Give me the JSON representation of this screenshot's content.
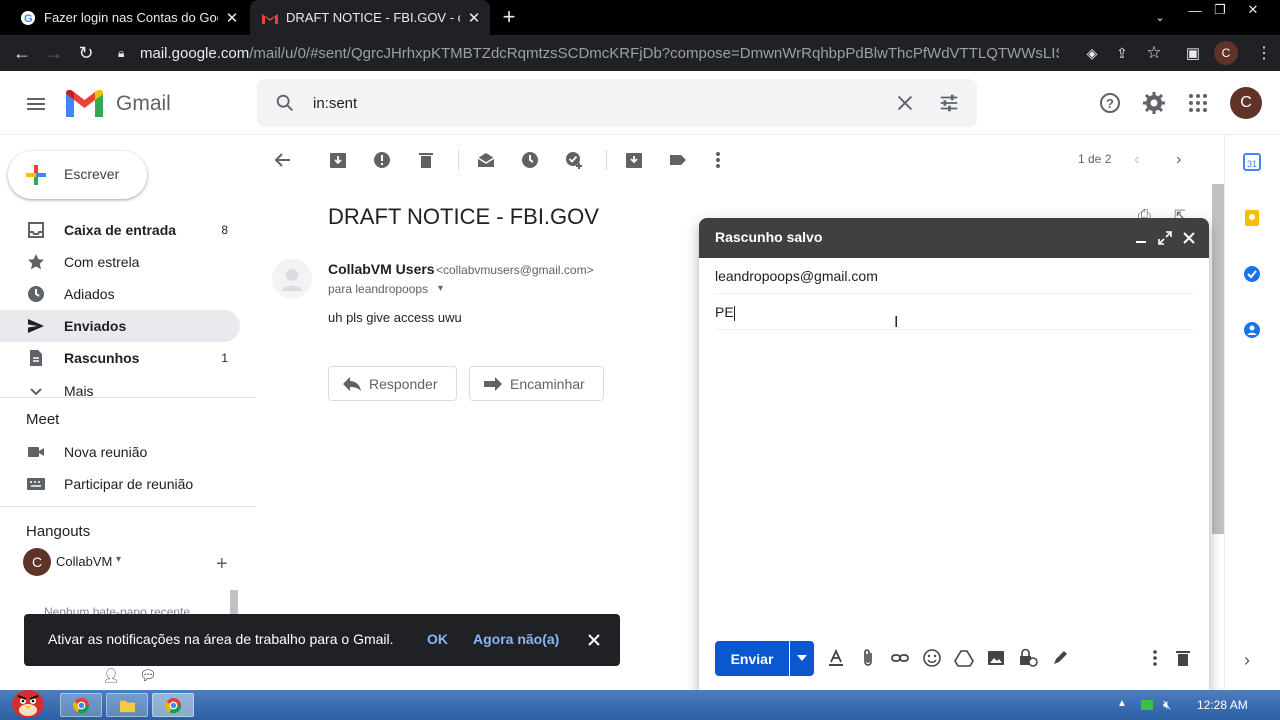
{
  "browser": {
    "tabs": [
      {
        "title": "Fazer login nas Contas do Goo"
      },
      {
        "title": "DRAFT NOTICE - FBI.GOV - coll"
      }
    ],
    "url_host": "mail.google.com",
    "url_path": "/mail/u/0/#sent/QgrcJHrhxpKTMBTZdcRqmtzsSCDmcKRFjDb?compose=DmwnWrRqhbpPdBlwThcPfWdVTTLQTWWsLIS...",
    "profile_initial": "C"
  },
  "header": {
    "app_name": "Gmail",
    "search_query": "in:sent",
    "avatar_initial": "C"
  },
  "sidebar": {
    "compose_label": "Escrever",
    "items": [
      {
        "label": "Caixa de entrada",
        "count": "8",
        "icon": "inbox-icon"
      },
      {
        "label": "Com estrela",
        "count": "",
        "icon": "star-icon"
      },
      {
        "label": "Adiados",
        "count": "",
        "icon": "clock-icon"
      },
      {
        "label": "Enviados",
        "count": "",
        "icon": "send-icon"
      },
      {
        "label": "Rascunhos",
        "count": "1",
        "icon": "draft-icon"
      },
      {
        "label": "Mais",
        "count": "",
        "icon": "chevron-down-icon"
      }
    ],
    "meet_title": "Meet",
    "meet_items": [
      {
        "label": "Nova reunião"
      },
      {
        "label": "Participar de reunião"
      }
    ],
    "hangouts_title": "Hangouts",
    "hangouts_user": "CollabVM",
    "hangouts_initial": "C",
    "hangouts_empty": "Nenhum bate-papo recente"
  },
  "toolbar": {
    "pager": "1 de 2"
  },
  "message": {
    "subject": "DRAFT NOTICE - FBI.GOV",
    "sender_name": "CollabVM Users",
    "sender_email": "<collabvmusers@gmail.com>",
    "to_line": "para leandropoops",
    "body": "uh pls give access  uwu",
    "reply_label": "Responder",
    "forward_label": "Encaminhar"
  },
  "compose": {
    "title": "Rascunho salvo",
    "to": "leandropoops@gmail.com",
    "subject": "PE",
    "send_label": "Enviar"
  },
  "snackbar": {
    "text": "Ativar as notificações na área de trabalho para o Gmail.",
    "ok": "OK",
    "later": "Agora não(a)"
  },
  "taskbar": {
    "clock": "12:28 AM"
  },
  "colors": {
    "accent": "#0b57d0",
    "selected_nav": "#e8eaed",
    "compose_header": "#404040",
    "avatar": "#5f3328",
    "link": "#8ab4f8"
  }
}
